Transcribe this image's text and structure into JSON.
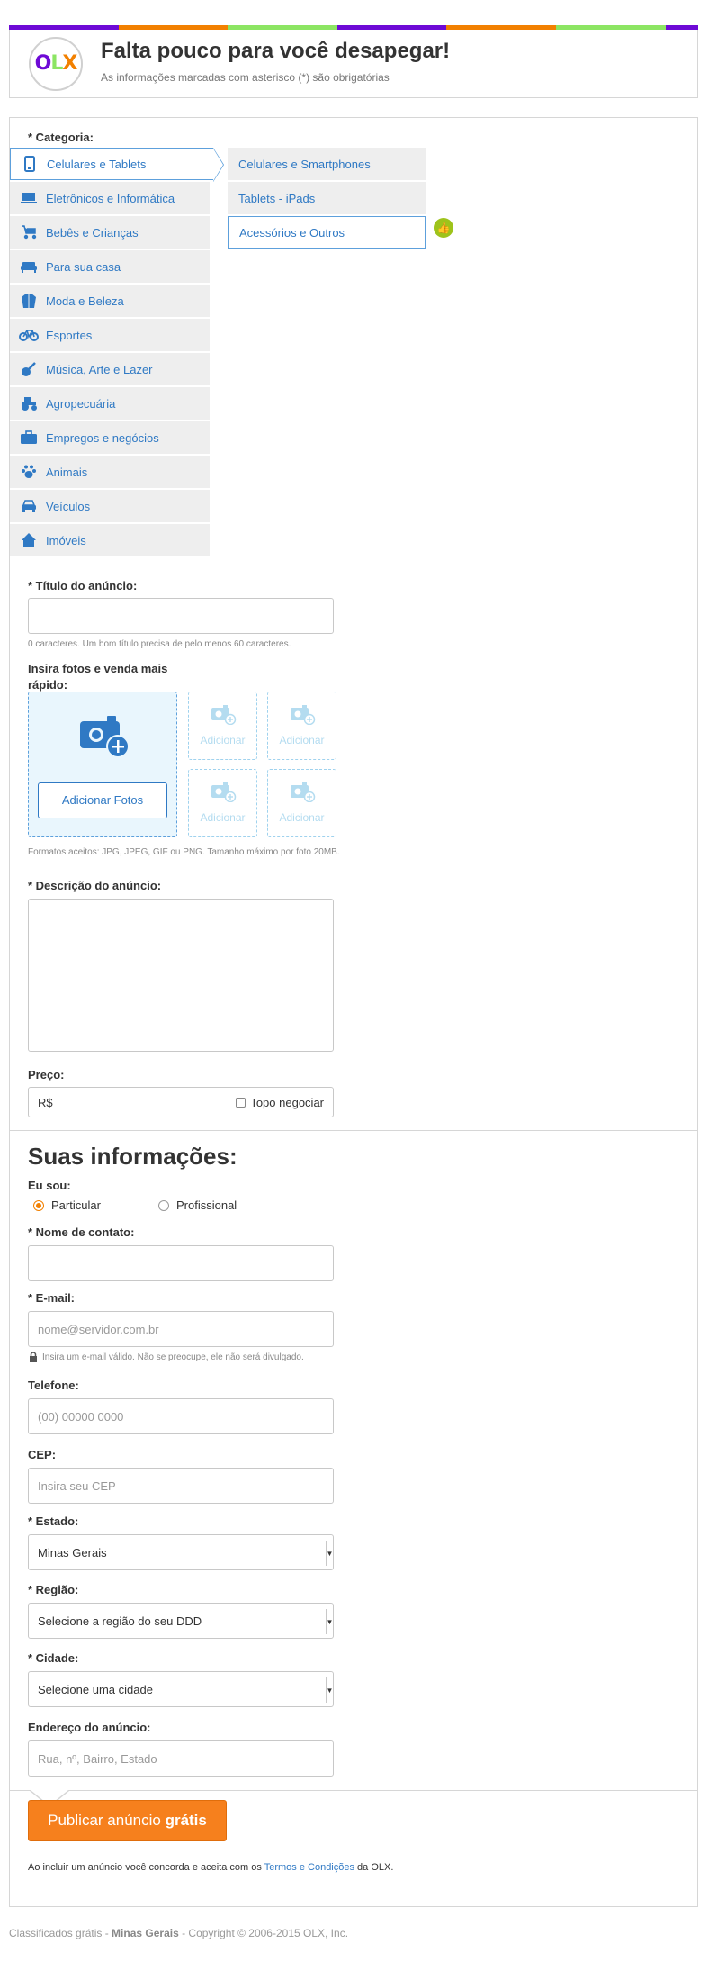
{
  "header": {
    "logo": {
      "o": "O",
      "l": "L",
      "x": "X"
    },
    "title": "Falta pouco para você desapegar!",
    "subtitle": "As informações marcadas com asterisco (*) são obrigatórias"
  },
  "colors": {
    "purple": "#6e0ad6",
    "orange": "#f28000",
    "green": "#8ce563",
    "link": "#2f79c4",
    "button": "#f6801d"
  },
  "category": {
    "label": "* Categoria:",
    "items": [
      {
        "label": "Celulares e Tablets",
        "icon": "mobile-phone-icon"
      },
      {
        "label": "Eletrônicos e Informática",
        "icon": "laptop-icon"
      },
      {
        "label": "Bebês e Crianças",
        "icon": "stroller-icon"
      },
      {
        "label": "Para sua casa",
        "icon": "sofa-icon"
      },
      {
        "label": "Moda e Beleza",
        "icon": "jacket-icon"
      },
      {
        "label": "Esportes",
        "icon": "bicycle-icon"
      },
      {
        "label": "Música, Arte e Lazer",
        "icon": "guitar-icon"
      },
      {
        "label": "Agropecuária",
        "icon": "tractor-icon"
      },
      {
        "label": "Empregos e negócios",
        "icon": "briefcase-icon"
      },
      {
        "label": "Animais",
        "icon": "paw-icon"
      },
      {
        "label": "Veículos",
        "icon": "car-icon"
      },
      {
        "label": "Imóveis",
        "icon": "house-icon"
      }
    ],
    "subitems": [
      {
        "label": "Celulares e Smartphones"
      },
      {
        "label": "Tablets - iPads"
      },
      {
        "label": "Acessórios e Outros"
      }
    ]
  },
  "title_field": {
    "label": "* Título do anúncio:",
    "value": "",
    "help": "0 caracteres. Um bom título precisa de pelo menos 60 caracteres."
  },
  "photos": {
    "label": "Insira fotos e venda mais rápido:",
    "button": "Adicionar Fotos",
    "slot_label": "Adicionar",
    "help": "Formatos aceitos: JPG, JPEG, GIF ou PNG. Tamanho máximo por foto 20MB."
  },
  "description": {
    "label": "* Descrição do anúncio:",
    "value": ""
  },
  "price": {
    "label": "Preço:",
    "prefix": "R$",
    "negotiate": "Topo negociar"
  },
  "your_info": {
    "title": "Suas informações:",
    "iam_label": "Eu sou:",
    "options": [
      "Particular",
      "Profissional"
    ],
    "selected": "Particular"
  },
  "contact_name": {
    "label": "* Nome de contato:",
    "value": ""
  },
  "email": {
    "label": "* E-mail:",
    "placeholder": "nome@servidor.com.br",
    "help": "Insira um e-mail válido. Não se preocupe, ele não será divulgado."
  },
  "phone": {
    "label": "Telefone:",
    "placeholder": "(00) 00000 0000"
  },
  "cep": {
    "label": "CEP:",
    "placeholder": "Insira seu CEP"
  },
  "state": {
    "label": "* Estado:",
    "value": "Minas Gerais"
  },
  "region": {
    "label": "* Região:",
    "value": "Selecione a região do seu DDD"
  },
  "city": {
    "label": "* Cidade:",
    "value": "Selecione uma cidade"
  },
  "address": {
    "label": "Endereço do anúncio:",
    "placeholder": "Rua, nº, Bairro, Estado"
  },
  "publish": {
    "label_pre": "Publicar anúncio ",
    "label_bold": "grátis"
  },
  "terms": {
    "pre": "Ao incluir um anúncio você concorda e aceita com os ",
    "link": "Termos e Condições",
    "post": " da OLX."
  },
  "footer": {
    "pre": "Classificados grátis - ",
    "state": "Minas Gerais",
    "post": " - Copyright © 2006-2015 OLX, Inc."
  }
}
